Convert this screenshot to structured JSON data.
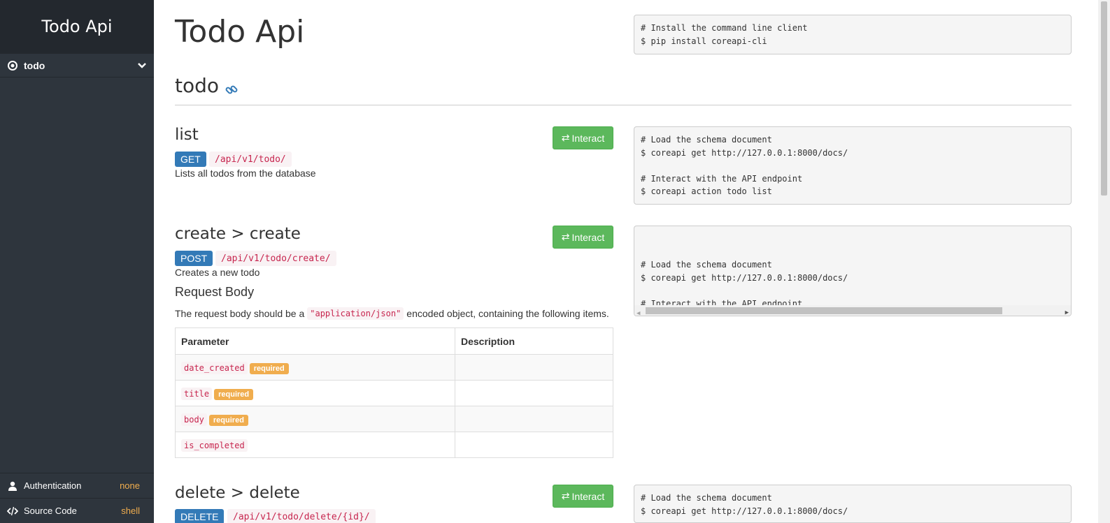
{
  "sidebar": {
    "brand": "Todo Api",
    "menu": [
      {
        "label": "todo"
      }
    ],
    "bottom": [
      {
        "label": "Authentication",
        "value": "none"
      },
      {
        "label": "Source Code",
        "value": "shell"
      }
    ]
  },
  "main": {
    "title": "Todo Api",
    "install_code": "# Install the command line client\n$ pip install coreapi-cli",
    "section": "todo",
    "endpoints": [
      {
        "title": "list",
        "method": "GET",
        "path": "/api/v1/todo/",
        "description": "Lists all todos from the database",
        "interact_label": "Interact",
        "code": "# Load the schema document\n$ coreapi get http://127.0.0.1:8000/docs/\n\n# Interact with the API endpoint\n$ coreapi action todo list"
      },
      {
        "title": "create > create",
        "method": "POST",
        "path": "/api/v1/todo/create/",
        "description": "Creates a new todo",
        "interact_label": "Interact",
        "request_body_heading": "Request Body",
        "request_body_text_pre": "The request body should be a",
        "request_body_code": "\"application/json\"",
        "request_body_text_post": "encoded object, containing the following items.",
        "table_headers": [
          "Parameter",
          "Description"
        ],
        "params": [
          {
            "name": "date_created",
            "required": "required"
          },
          {
            "name": "title",
            "required": "required"
          },
          {
            "name": "body",
            "required": "required"
          },
          {
            "name": "is_completed",
            "required": ""
          }
        ],
        "code": "# Load the schema document\n$ coreapi get http://127.0.0.1:8000/docs/\n\n# Interact with the API endpoint\n$ coreapi action todo create create -p date_created=... -p title=... -p body=... -p is_completed=..."
      },
      {
        "title": "delete > delete",
        "method": "DELETE",
        "path": "/api/v1/todo/delete/{id}/",
        "interact_label": "Interact",
        "code": "# Load the schema document\n$ coreapi get http://127.0.0.1:8000/docs/"
      }
    ]
  },
  "colors": {
    "sidebar_bg": "#2e353d",
    "brand_bg": "#23282e",
    "method_blue": "#337ab7",
    "interact_green": "#5cb85c",
    "required_orange": "#f0ad4e",
    "code_red": "#c7254e"
  },
  "icons": {
    "menu": "dot-circle-icon",
    "chevron": "chevron-down-icon",
    "section_link": "link-icon",
    "interact": "exchange-icon",
    "auth": "user-icon",
    "source": "code-icon"
  }
}
